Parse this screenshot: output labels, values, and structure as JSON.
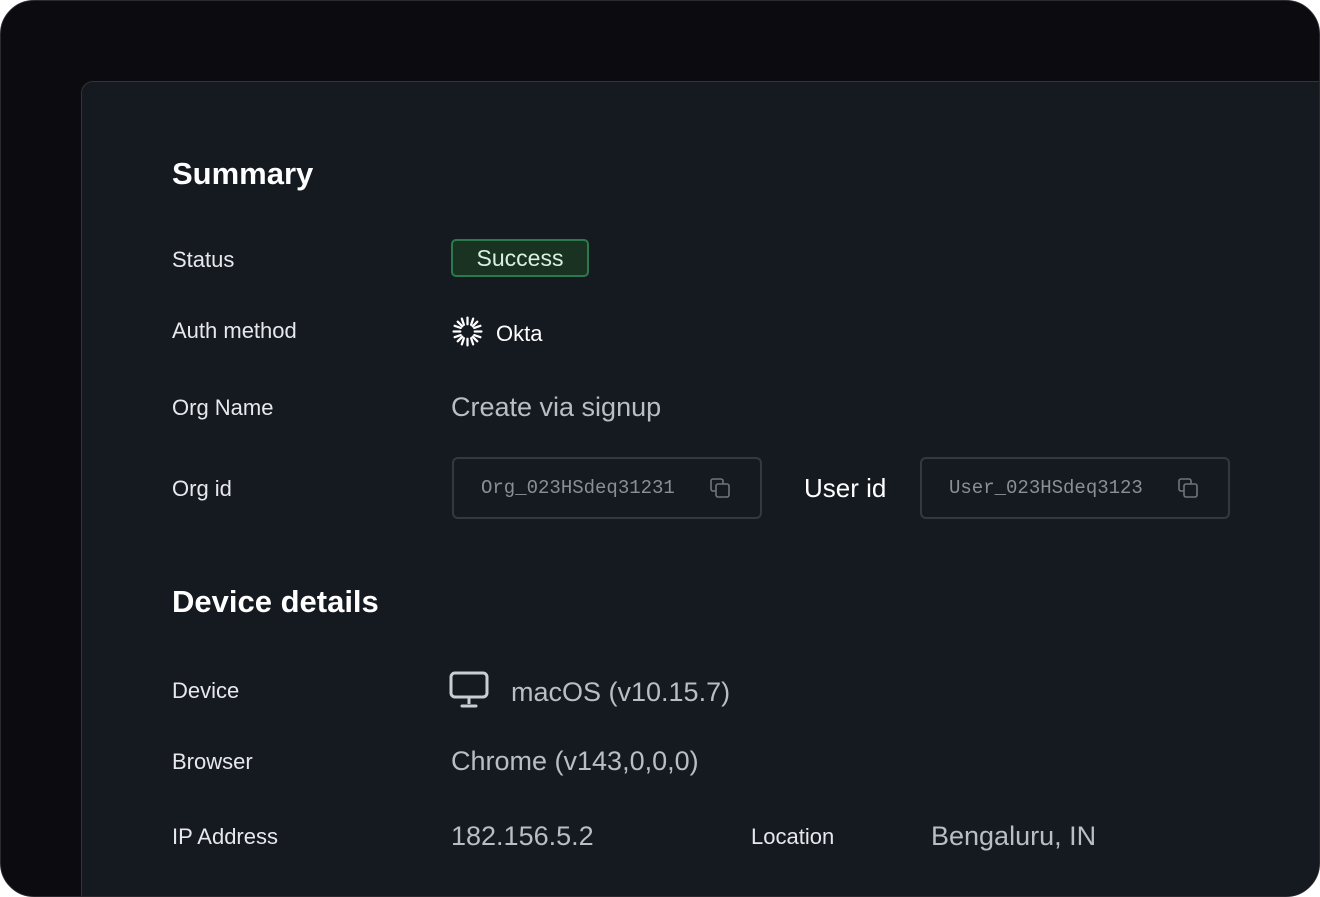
{
  "summary": {
    "title": "Summary",
    "status": {
      "label": "Status",
      "value": "Success",
      "color": "#2a7a4c"
    },
    "auth_method": {
      "label": "Auth method",
      "value": "Okta",
      "icon": "okta-icon"
    },
    "org_name": {
      "label": "Org Name",
      "value": "Create via signup"
    },
    "org_id": {
      "label": "Org id",
      "value": "Org_023HSdeq31231",
      "icon": "copy-icon"
    },
    "user_id": {
      "label": "User id",
      "value": "User_023HSdeq3123",
      "icon": "copy-icon"
    }
  },
  "device_details": {
    "title": "Device details",
    "device": {
      "label": "Device",
      "value": "macOS (v10.15.7)",
      "icon": "monitor-icon"
    },
    "browser": {
      "label": "Browser",
      "value": "Chrome (v143,0,0,0)"
    },
    "ip_address": {
      "label": "IP Address",
      "value": "182.156.5.2"
    },
    "location": {
      "label": "Location",
      "value": "Bengaluru, IN"
    }
  }
}
